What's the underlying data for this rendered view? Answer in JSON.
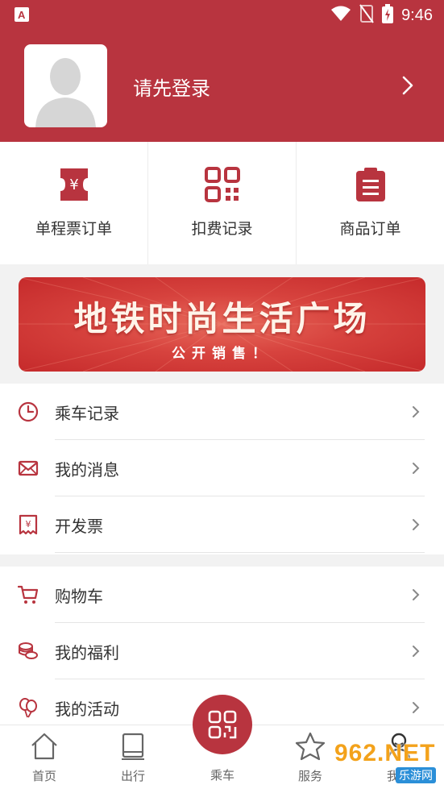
{
  "status_bar": {
    "time": "9:46",
    "icons": [
      "app-a-icon",
      "wifi-icon",
      "no-signal-icon",
      "battery-charging-icon"
    ]
  },
  "profile": {
    "login_prompt": "请先登录",
    "avatar_icon": "default-avatar-icon",
    "arrow_icon": "chevron-right-icon"
  },
  "orders": [
    {
      "label": "单程票订单",
      "icon": "ticket-yen-icon"
    },
    {
      "label": "扣费记录",
      "icon": "qr-code-icon"
    },
    {
      "label": "商品订单",
      "icon": "clipboard-list-icon"
    }
  ],
  "banner": {
    "title": "地铁时尚生活广场",
    "subtitle": "公开销售！"
  },
  "menu_group_1": [
    {
      "label": "乘车记录",
      "icon": "clock-icon"
    },
    {
      "label": "我的消息",
      "icon": "envelope-icon"
    },
    {
      "label": "开发票",
      "icon": "receipt-yen-icon"
    }
  ],
  "menu_group_2": [
    {
      "label": "购物车",
      "icon": "cart-icon"
    },
    {
      "label": "我的福利",
      "icon": "coins-icon"
    },
    {
      "label": "我的活动",
      "icon": "balloons-icon"
    }
  ],
  "bottom_nav": [
    {
      "label": "首页",
      "icon": "home-icon"
    },
    {
      "label": "出行",
      "icon": "tablet-icon"
    },
    {
      "label": "乘车",
      "icon": "ride-qr-icon"
    },
    {
      "label": "服务",
      "icon": "star-icon"
    },
    {
      "label": "我的",
      "icon": "user-icon"
    }
  ],
  "watermark": {
    "text": "962.NET",
    "sub": "乐游网"
  },
  "colors": {
    "brand": "#b8343f",
    "background": "#f2f2f2",
    "text": "#333333"
  }
}
